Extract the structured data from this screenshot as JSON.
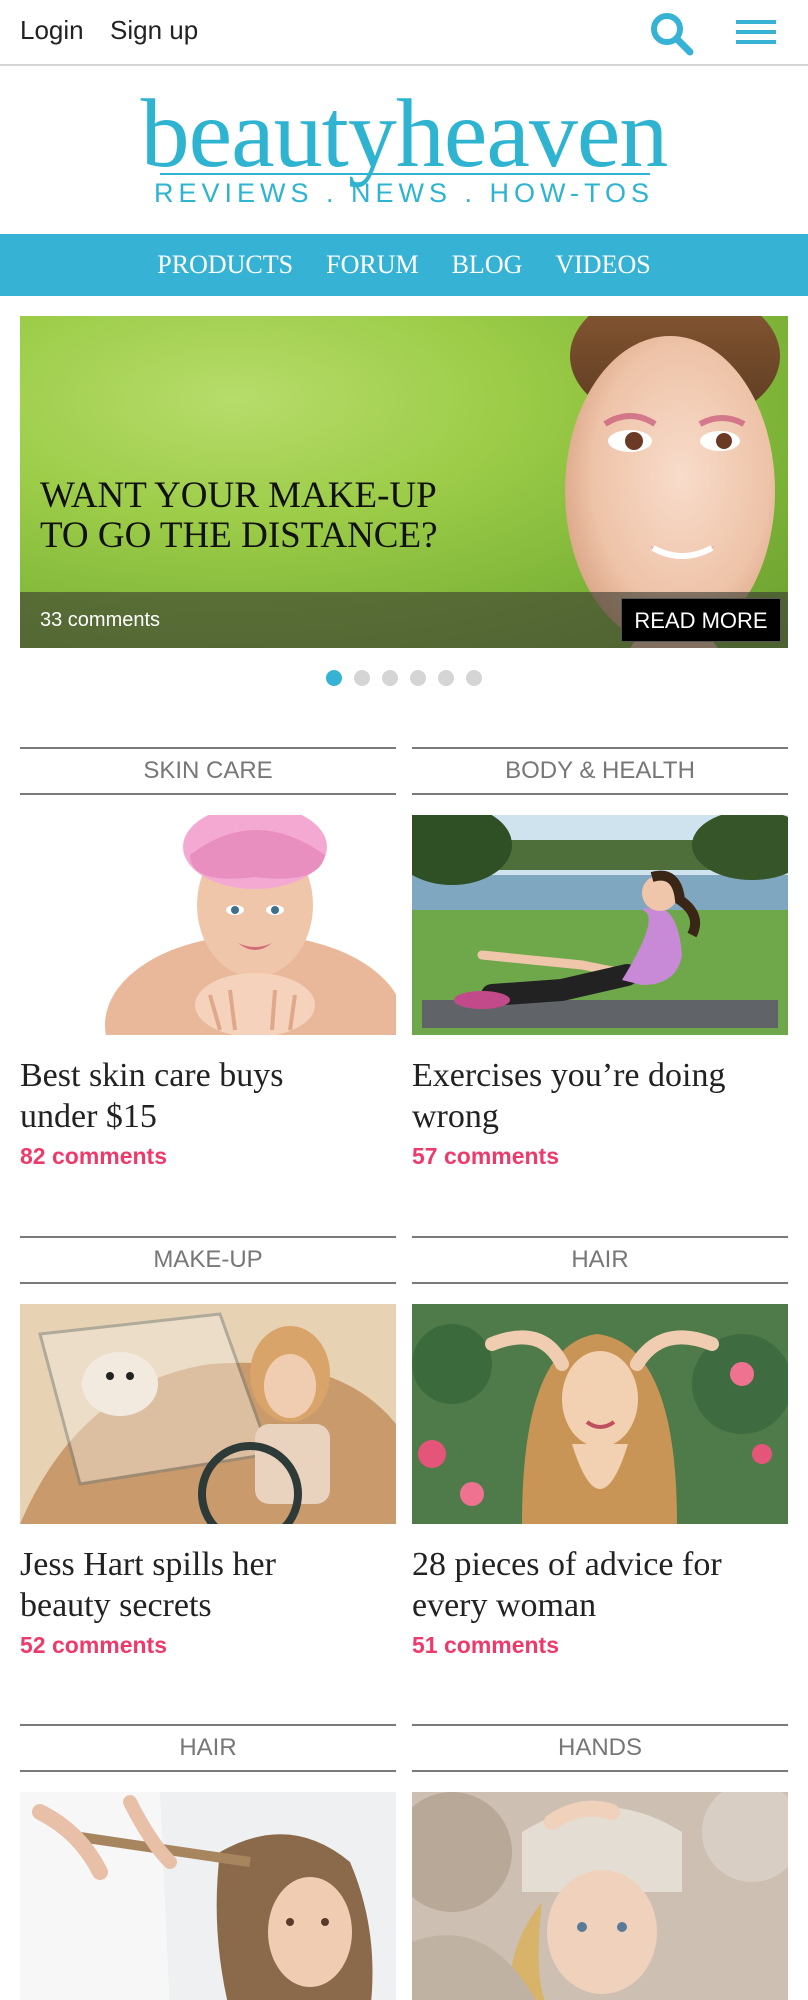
{
  "topbar": {
    "login": "Login",
    "signup": "Sign up",
    "search_icon": "search-icon",
    "menu_icon": "hamburger-menu-icon"
  },
  "logo": {
    "wordmark": "beautyheaven",
    "tagline": "REVIEWS . NEWS . HOW-TOS"
  },
  "nav": {
    "items": [
      "PRODUCTS",
      "FORUM",
      "BLOG",
      "VIDEOS"
    ]
  },
  "hero": {
    "headline_line1": "WANT YOUR MAKE-UP",
    "headline_line2": "TO GO THE DISTANCE?",
    "comments": "33 comments",
    "cta": "READ MORE",
    "slides_total": 6,
    "active_slide": 1
  },
  "articles": [
    {
      "category": "SKIN CARE",
      "title_line1": "Best skin care buys",
      "title_line2": "under $15",
      "comments": "82 comments"
    },
    {
      "category": "BODY & HEALTH",
      "title_line1": "Exercises you’re doing",
      "title_line2": "wrong",
      "comments": "57 comments"
    },
    {
      "category": "MAKE-UP",
      "title_line1": "Jess Hart spills her",
      "title_line2": "beauty secrets",
      "comments": "52 comments"
    },
    {
      "category": "HAIR",
      "title_line1": "28 pieces of advice for",
      "title_line2": "every woman",
      "comments": "51 comments"
    },
    {
      "category": "HAIR",
      "title_line1": "",
      "title_line2": "",
      "comments": ""
    },
    {
      "category": "HANDS",
      "title_line1": "",
      "title_line2": "",
      "comments": ""
    }
  ],
  "colors": {
    "brand": "#36b3d4",
    "comment_pink": "#ee3a6a"
  }
}
